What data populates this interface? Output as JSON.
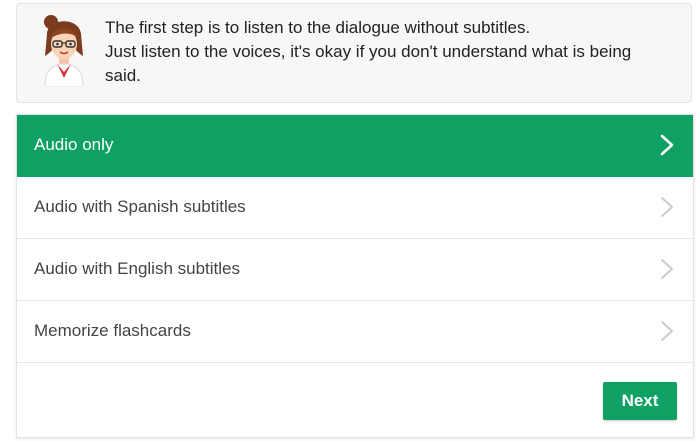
{
  "instruction": {
    "lines": [
      "The first step is to listen to the dialogue without subtitles.",
      "Just listen to the voices, it's okay if you don't understand what is being",
      "said."
    ],
    "avatar_icon": "teacher-avatar-icon"
  },
  "options": [
    {
      "label": "Audio only",
      "selected": true
    },
    {
      "label": "Audio with Spanish subtitles",
      "selected": false
    },
    {
      "label": "Audio with English subtitles",
      "selected": false
    },
    {
      "label": "Memorize flashcards",
      "selected": false
    }
  ],
  "next_button": {
    "label": "Next"
  },
  "colors": {
    "accent": "#0fa164",
    "text": "#444444",
    "chevron_inactive": "#cccccc"
  },
  "icons": {
    "option_arrow": "chevron-right-icon"
  }
}
